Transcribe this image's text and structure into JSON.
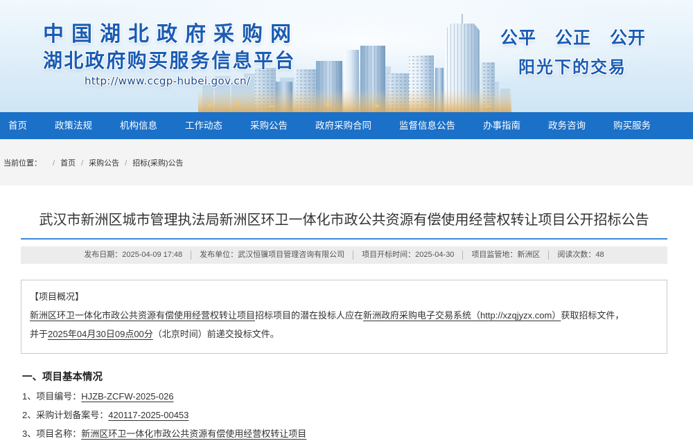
{
  "header": {
    "site_title": "中国湖北政府采购网",
    "platform_title": "湖北政府购买服务信息平台",
    "url": "http://www.ccgp-hubei.gov.cn/",
    "slogan_words": [
      "公平",
      "公正",
      "公开"
    ],
    "slogan_line2": "阳光下的交易",
    "illustration": "city-skyline"
  },
  "nav": {
    "items": [
      "首页",
      "政策法规",
      "机构信息",
      "工作动态",
      "采购公告",
      "政府采购合同",
      "监督信息公告",
      "办事指南",
      "政务咨询",
      "购买服务"
    ]
  },
  "breadcrumb": {
    "label": "当前位置：",
    "separator": "/",
    "items": [
      "首页",
      "采购公告",
      "招标(采购)公告"
    ]
  },
  "article": {
    "title": "武汉市新洲区城市管理执法局新洲区环卫一体化市政公共资源有偿使用经营权转让项目公开招标公告",
    "meta": [
      {
        "label": "发布日期：",
        "value": "2025-04-09 17:48"
      },
      {
        "label": "发布单位：",
        "value": "武汉恒骥项目管理咨询有限公司"
      },
      {
        "label": "项目开标时间：",
        "value": "2025-04-30"
      },
      {
        "label": "项目监管地：",
        "value": "新洲区"
      },
      {
        "label": "阅读次数：",
        "value": "48"
      }
    ],
    "overview": {
      "heading": "【项目概况】",
      "line1": [
        "新洲区环卫一体化市政公共资源有偿使用经营权转让项目",
        "招标项目的潜在投标人应在",
        "新洲政府采购电子交易系统（http://xzqjyzx.com）",
        "获取招标文件，"
      ],
      "line2": [
        "并于",
        "2025年04月30日09点00分",
        "（北京时间）前递交投标文件。"
      ]
    },
    "section1": {
      "heading": "一、项目基本情况",
      "items": [
        {
          "label": "1、项目编号：",
          "value": "HJZB-ZCFW-2025-026"
        },
        {
          "label": "2、采购计划备案号：",
          "value": "420117-2025-00453"
        },
        {
          "label": "3、项目名称：",
          "value": "新洲区环卫一体化市政公共资源有偿使用经营权转让项目"
        }
      ]
    }
  },
  "colors": {
    "nav_bg": "#1b70c8",
    "brand_blue": "#1a5cb4",
    "title_rule": "#3b8ad8",
    "meta_bg": "#ececec",
    "box_border": "#c9c9c9"
  }
}
